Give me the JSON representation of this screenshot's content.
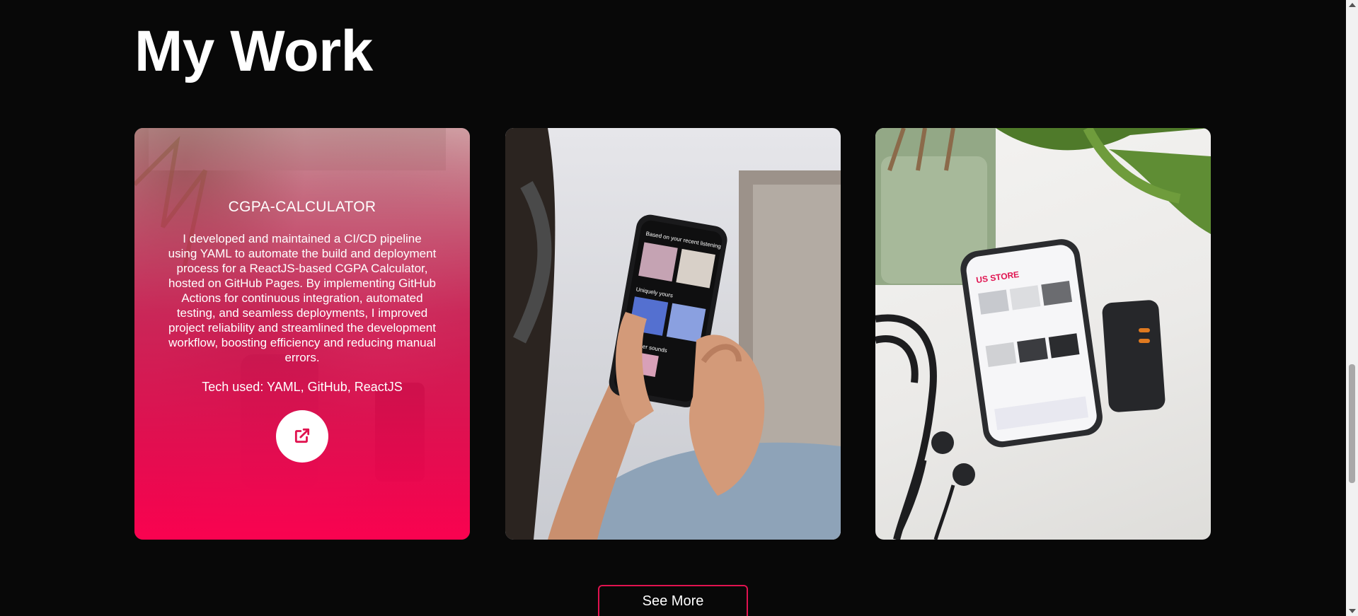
{
  "section": {
    "title": "My Work"
  },
  "projects": [
    {
      "title": "CGPA-CALCULATOR",
      "description": "I developed and maintained a CI/CD pipeline using YAML to automate the build and deployment process for a ReactJS-based CGPA Calculator, hosted on GitHub Pages. By implementing GitHub Actions for continuous integration, automated testing, and seamless deployments, I improved project reliability and streamlined the development workflow, boosting efficiency and reducing manual errors.",
      "tech": "Tech used: YAML, GitHub, ReactJS",
      "link_icon": "external-link-icon"
    },
    {
      "image": "hands-holding-phone-music-app",
      "screen": {
        "heading": "Based on your recent listening",
        "section": "Uniquely yours",
        "section2": "Summer sounds"
      }
    },
    {
      "image": "phone-ecommerce-store-on-desk",
      "screen": {
        "brand": "US STORE"
      }
    }
  ],
  "see_more": {
    "label": "See More"
  },
  "colors": {
    "accent": "#ff0050",
    "background": "#080808",
    "button_border": "#e0124f"
  }
}
